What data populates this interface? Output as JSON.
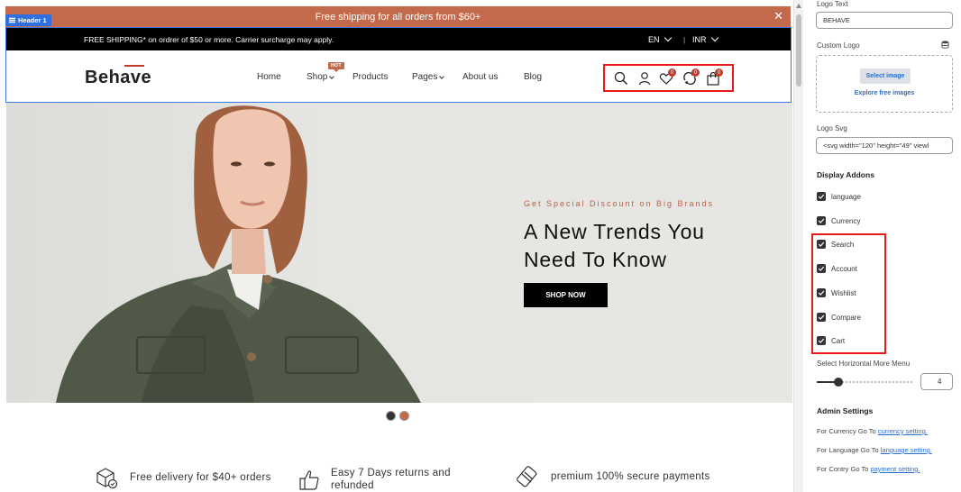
{
  "promo": {
    "text": "Free shipping for all orders from $60+",
    "close": "✕"
  },
  "header_tag": "Header 1",
  "topbar": {
    "shipping": "FREE SHIPPING* on ordrer of $50 or more. Carrier surcharge may apply.",
    "language": "EN",
    "separator": "|",
    "currency": "INR"
  },
  "logo": "Behave",
  "nav": {
    "items": [
      {
        "label": "Home"
      },
      {
        "label": "Shop"
      },
      {
        "label": "Products"
      },
      {
        "label": "Pages"
      },
      {
        "label": "About us"
      },
      {
        "label": "Blog"
      }
    ],
    "hot_badge": "HOT"
  },
  "header_icons": {
    "wishlist_count": "0",
    "compare_count": "0",
    "cart_count": "0"
  },
  "hero": {
    "subtitle": "Get Special Discount on Big Brands",
    "title_line1": "A New Trends You",
    "title_line2": "Need To Know",
    "button": "SHOP NOW"
  },
  "features": [
    {
      "text": "Free delivery for $40+ orders"
    },
    {
      "line1": "Easy 7 Days returns and",
      "line2": "refunded"
    },
    {
      "text": "premium 100% secure payments"
    }
  ],
  "panel": {
    "logo_text_label": "Logo Text",
    "logo_text_value": "BEHAVE",
    "custom_logo_label": "Custom Logo",
    "select_image": "Select image",
    "explore_images": "Explore free images",
    "logo_svg_label": "Logo Svg",
    "logo_svg_value": "<svg width=\"120\" height=\"49\" viewl",
    "display_addons_title": "Display Addons",
    "addons": [
      {
        "label": "language",
        "checked": true
      },
      {
        "label": "Currency",
        "checked": true
      },
      {
        "label": "Search",
        "checked": true
      },
      {
        "label": "Account",
        "checked": true
      },
      {
        "label": "Wishlist",
        "checked": true
      },
      {
        "label": "Compare",
        "checked": true
      },
      {
        "label": "Cart",
        "checked": true
      }
    ],
    "more_menu_label": "Select Horizontal More Menu",
    "more_menu_value": "4",
    "more_menu_fraction": 0.2,
    "admin_title": "Admin Settings",
    "admin_lines": [
      {
        "prefix": "For Currency Go To ",
        "link": "currency setting."
      },
      {
        "prefix": "For Language Go To ",
        "link": "language setting."
      },
      {
        "prefix": "For Contry Go To ",
        "link": "payment setting."
      }
    ]
  },
  "colors": {
    "accent": "#c26a4b",
    "highlight": "#e81b1b",
    "selection": "#3b7be6",
    "link": "#2c6ecb"
  }
}
